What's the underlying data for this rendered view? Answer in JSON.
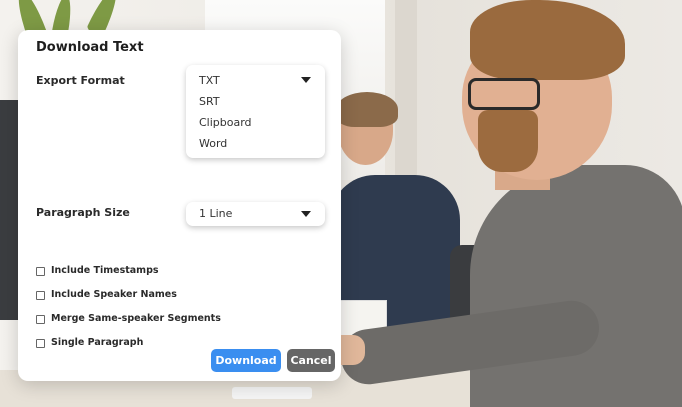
{
  "dialog": {
    "title": "Download Text",
    "export_format": {
      "label": "Export Format",
      "options": [
        "TXT",
        "SRT",
        "Clipboard",
        "Word"
      ]
    },
    "paragraph_size": {
      "label": "Paragraph Size",
      "value": "1 Line"
    },
    "checkboxes": [
      {
        "label": "Include Timestamps",
        "checked": false
      },
      {
        "label": "Include Speaker Names",
        "checked": false
      },
      {
        "label": "Merge Same-speaker Segments",
        "checked": false
      },
      {
        "label": "Single Paragraph",
        "checked": false
      }
    ],
    "buttons": {
      "download": "Download",
      "cancel": "Cancel"
    }
  },
  "colors": {
    "download_button": "#3a8ef0",
    "cancel_button": "#666666"
  }
}
